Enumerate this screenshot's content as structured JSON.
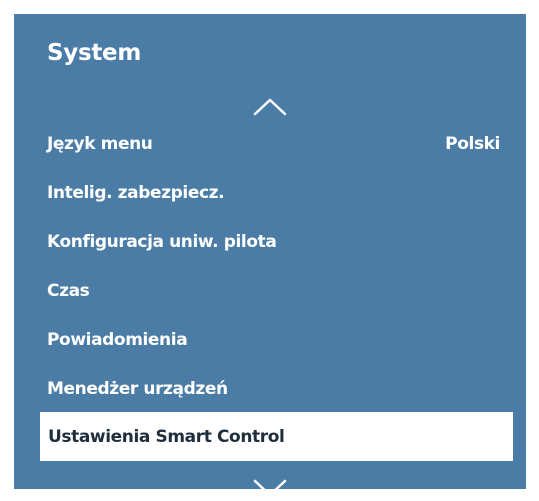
{
  "panel": {
    "title": "System",
    "colors": {
      "background": "#4a7ca6",
      "selected_bg": "#ffffff",
      "selected_text": "#1f2e3d",
      "text": "#ffffff"
    }
  },
  "nav": {
    "up_icon": "chevron-up-icon",
    "down_icon": "chevron-down-icon"
  },
  "menu": {
    "items": [
      {
        "label": "Język menu",
        "value": "Polski"
      },
      {
        "label": "Intelig. zabezpiecz."
      },
      {
        "label": "Konfiguracja uniw. pilota"
      },
      {
        "label": "Czas"
      },
      {
        "label": "Powiadomienia"
      },
      {
        "label": "Menedżer urządzeń"
      },
      {
        "label": "Ustawienia Smart Control",
        "selected": true
      }
    ]
  }
}
